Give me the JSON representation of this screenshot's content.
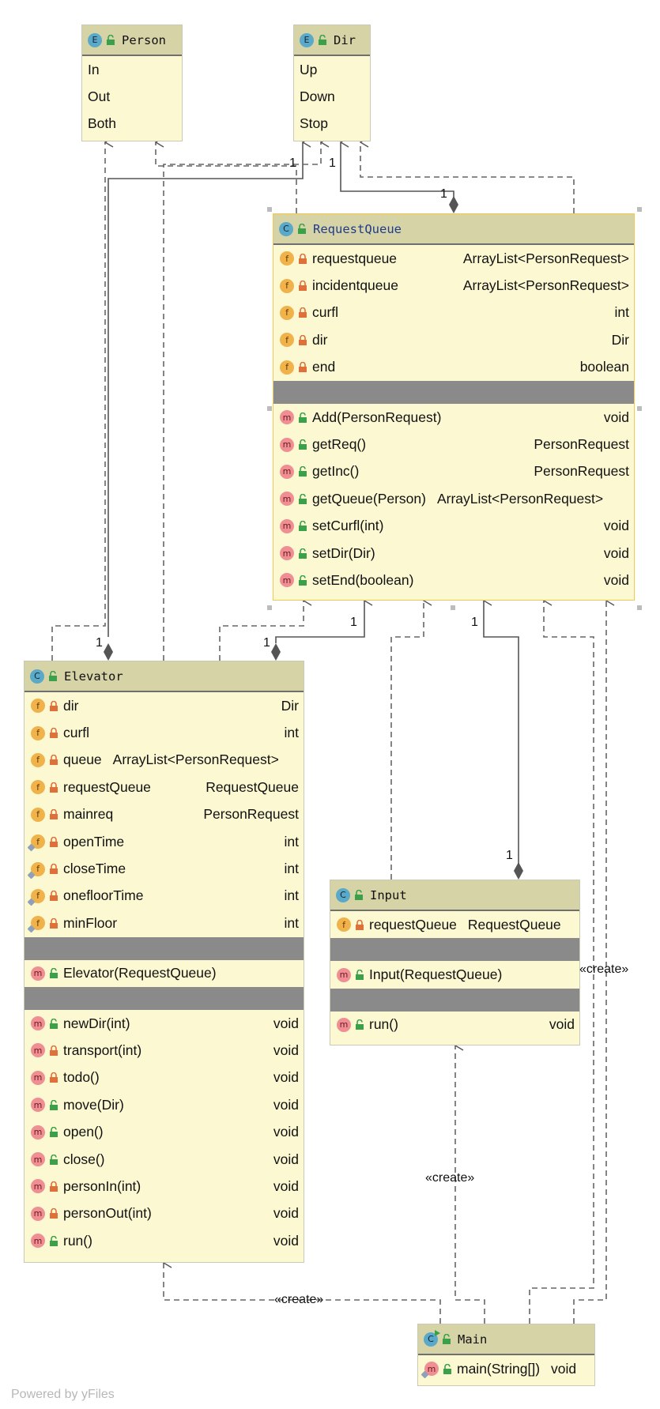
{
  "classes": {
    "person": {
      "kind": "E",
      "name": "Person",
      "constants": [
        "In",
        "Out",
        "Both"
      ]
    },
    "dir": {
      "kind": "E",
      "name": "Dir",
      "constants": [
        "Up",
        "Down",
        "Stop"
      ]
    },
    "request_queue": {
      "kind": "C",
      "name": "RequestQueue",
      "fields": [
        {
          "kind": "f",
          "name": "requestqueue",
          "type": "ArrayList<PersonRequest>"
        },
        {
          "kind": "f",
          "name": "incidentqueue",
          "type": "ArrayList<PersonRequest>"
        },
        {
          "kind": "f",
          "name": "curfl",
          "type": "int"
        },
        {
          "kind": "f",
          "name": "dir",
          "type": "Dir"
        },
        {
          "kind": "f",
          "name": "end",
          "type": "boolean"
        }
      ],
      "methods": [
        {
          "kind": "m",
          "name": "Add(PersonRequest)",
          "type": "void"
        },
        {
          "kind": "m",
          "name": "getReq()",
          "type": "PersonRequest"
        },
        {
          "kind": "m",
          "name": "getInc()",
          "type": "PersonRequest"
        },
        {
          "kind": "m",
          "name": "getQueue(Person)",
          "type": "ArrayList<PersonRequest>"
        },
        {
          "kind": "m",
          "name": "setCurfl(int)",
          "type": "void"
        },
        {
          "kind": "m",
          "name": "setDir(Dir)",
          "type": "void"
        },
        {
          "kind": "m",
          "name": "setEnd(boolean)",
          "type": "void"
        }
      ]
    },
    "elevator": {
      "kind": "C",
      "name": "Elevator",
      "fields": [
        {
          "kind": "f",
          "name": "dir",
          "type": "Dir"
        },
        {
          "kind": "f",
          "name": "curfl",
          "type": "int"
        },
        {
          "kind": "f",
          "name": "queue",
          "type": "ArrayList<PersonRequest>"
        },
        {
          "kind": "f",
          "name": "requestQueue",
          "type": "RequestQueue"
        },
        {
          "kind": "f",
          "name": "mainreq",
          "type": "PersonRequest"
        },
        {
          "kind": "f",
          "name": "openTime",
          "type": "int"
        },
        {
          "kind": "f",
          "name": "closeTime",
          "type": "int"
        },
        {
          "kind": "f",
          "name": "onefloorTime",
          "type": "int"
        },
        {
          "kind": "f",
          "name": "minFloor",
          "type": "int"
        }
      ],
      "constructors": [
        {
          "kind": "m",
          "name": "Elevator(RequestQueue)"
        }
      ],
      "methods": [
        {
          "kind": "m",
          "name": "newDir(int)",
          "type": "void"
        },
        {
          "kind": "m",
          "name": "transport(int)",
          "type": "void"
        },
        {
          "kind": "m",
          "name": "todo()",
          "type": "void"
        },
        {
          "kind": "m",
          "name": "move(Dir)",
          "type": "void"
        },
        {
          "kind": "m",
          "name": "open()",
          "type": "void"
        },
        {
          "kind": "m",
          "name": "close()",
          "type": "void"
        },
        {
          "kind": "m",
          "name": "personIn(int)",
          "type": "void"
        },
        {
          "kind": "m",
          "name": "personOut(int)",
          "type": "void"
        },
        {
          "kind": "m",
          "name": "run()",
          "type": "void"
        }
      ]
    },
    "input": {
      "kind": "C",
      "name": "Input",
      "fields": [
        {
          "kind": "f",
          "name": "requestQueue",
          "type": "RequestQueue"
        }
      ],
      "constructors": [
        {
          "kind": "m",
          "name": "Input(RequestQueue)"
        }
      ],
      "methods": [
        {
          "kind": "m",
          "name": "run()",
          "type": "void"
        }
      ]
    },
    "main": {
      "kind": "C",
      "name": "Main",
      "methods": [
        {
          "kind": "m",
          "name": "main(String[])",
          "type": "void"
        }
      ]
    }
  },
  "multiplicities": {
    "elevator_dir": "1",
    "requestqueue_dir": "1",
    "requestqueue_dir_end": "1",
    "elevator_requestqueue_end": "1",
    "elevator_requestqueue_start": "1",
    "elevator_dir_start": "1",
    "input_requestqueue_end": "1",
    "input_requestqueue_start": "1"
  },
  "stereotypes": {
    "main_input": "«create»",
    "main_elevator": "«create»",
    "main_requestqueue": "«create»"
  },
  "footer": "Powered by yFiles",
  "colors": {
    "class_fill": "#fcf9d2",
    "header_fill": "#d6d3a6",
    "separator": "#8a8a8a",
    "selection": "#f2c94c",
    "edge": "#666666"
  }
}
